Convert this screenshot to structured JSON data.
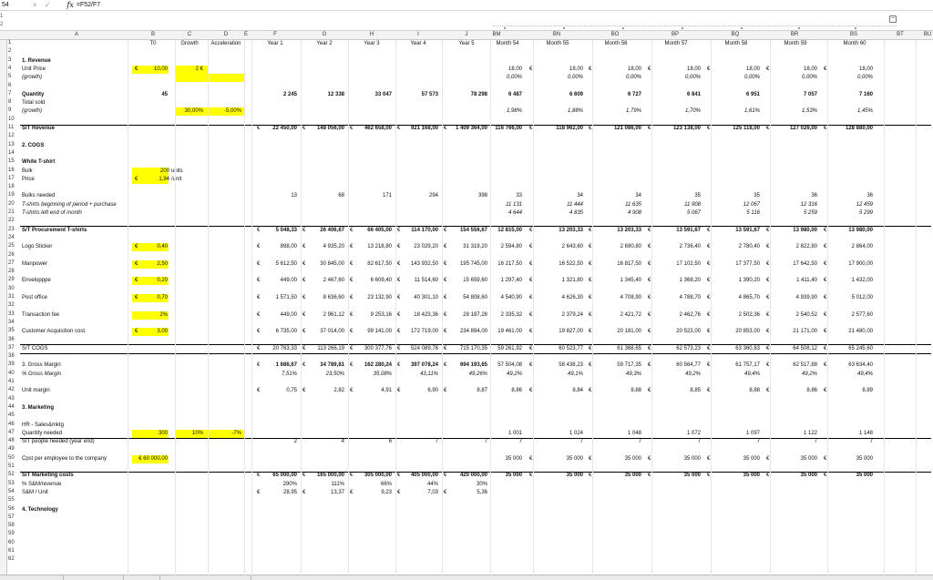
{
  "formula_bar": {
    "cell_ref": "54",
    "cancel": "×",
    "confirm": "✓",
    "fx": "fx",
    "formula": "=F52/F7"
  },
  "columns": [
    "A",
    "B",
    "C",
    "D",
    "E",
    "F",
    "G",
    "H",
    "I",
    "J",
    "BM",
    "BN",
    "BO",
    "BP",
    "BQ",
    "BR",
    "BS",
    "BT",
    "BU"
  ],
  "header_row": {
    "rn": "1",
    "b": "T0",
    "c": "Growth",
    "d": "Acceleration",
    "f": "Year 1",
    "g": "Year 2",
    "h": "Year 3",
    "i": "Year 4",
    "j": "Year 5",
    "bm": "Month 54",
    "bn": "Month 55",
    "bo": "Month 56",
    "bp": "Month 57",
    "bq": "Month 58",
    "br": "Month 59",
    "bs": "Month 60"
  },
  "euro": "€",
  "rows": [
    {
      "rn": "2"
    },
    {
      "rn": "3",
      "a": "1. Revenue",
      "bold": true
    },
    {
      "rn": "4",
      "a": "Unit Price",
      "b": "10,00",
      "b_euro": true,
      "b_hl": true,
      "c": "2 €",
      "c_hl": true,
      "months": [
        "18,00",
        "18,00",
        "18,00",
        "18,00",
        "18,00",
        "18,00",
        "18,00"
      ],
      "month_euro": true
    },
    {
      "rn": "5",
      "a": "(growth)",
      "italic": true,
      "c_hl": true,
      "d_hl": true,
      "months": [
        "0,00%",
        "0,00%",
        "0,00%",
        "0,00%",
        "0,00%",
        "0,00%",
        "0,00%"
      ],
      "mitalic": true
    },
    {
      "rn": "6"
    },
    {
      "rn": "7",
      "a": "Quantity",
      "b": "45",
      "years": [
        "2 245",
        "12 338",
        "33 047",
        "57 573",
        "78 298"
      ],
      "months": [
        "6 487",
        "6 609",
        "6 727",
        "6 841",
        "6 951",
        "7 057",
        "7 160"
      ],
      "bold": true
    },
    {
      "rn": "8",
      "a": "Total sold"
    },
    {
      "rn": "9",
      "a": "(growth)",
      "italic": true,
      "c": "30,00%",
      "c_hl": true,
      "d": "-5,00%",
      "d_hl": true,
      "months": [
        "1,98%",
        "1,88%",
        "1,79%",
        "1,70%",
        "1,61%",
        "1,53%",
        "1,45%"
      ],
      "mitalic": true
    },
    {
      "rn": "10"
    },
    {
      "rn": "11",
      "a": "S/T Revenue",
      "bold": true,
      "year_euro": true,
      "years": [
        "22 450,00",
        "148 056,00",
        "462 658,00",
        "921 168,00",
        "1 409 364,00"
      ],
      "months": [
        "116 766,00",
        "118 962,00",
        "121 086,00",
        "123 138,00",
        "125 118,00",
        "127 026,00",
        "128 880,00"
      ],
      "month_euro": true,
      "rule_top": true
    },
    {
      "rn": "12"
    },
    {
      "rn": "13",
      "a": "2. COGS",
      "bold": true
    },
    {
      "rn": "14"
    },
    {
      "rn": "15",
      "a": "White T-shirt",
      "bold": true
    },
    {
      "rn": "16",
      "a": "Bulk",
      "b": "200",
      "b_hl": true,
      "c": "units"
    },
    {
      "rn": "17",
      "a": "Price",
      "b": "1,94",
      "b_euro": true,
      "b_hl": true,
      "c": "/unit"
    },
    {
      "rn": "18"
    },
    {
      "rn": "19",
      "a": "Bulks needed",
      "years": [
        "13",
        "68",
        "171",
        "294",
        "398"
      ],
      "months": [
        "33",
        "34",
        "34",
        "35",
        "35",
        "36",
        "36"
      ]
    },
    {
      "rn": "20",
      "a": "T-shirts beginning of period + purchase",
      "italic": true,
      "months": [
        "11 131",
        "11 444",
        "11 635",
        "11 908",
        "12 067",
        "12 316",
        "12 459"
      ],
      "mitalic": true
    },
    {
      "rn": "21",
      "a": "T-shirts left end of month",
      "italic": true,
      "months": [
        "4 644",
        "4 835",
        "4 908",
        "5 067",
        "5 116",
        "5 259",
        "5 299"
      ],
      "mitalic": true
    },
    {
      "rn": "22"
    },
    {
      "rn": "23",
      "a": "S/T Procurement T-shirts",
      "bold": true,
      "year_euro": true,
      "years": [
        "5 048,33",
        "26 406,67",
        "66 405,00",
        "114 170,00",
        "154 556,67"
      ],
      "months": [
        "12 815,00",
        "13 203,33",
        "13 203,33",
        "13 591,67",
        "13 591,67",
        "13 980,00",
        "13 980,00"
      ],
      "month_euro": true,
      "rule_top": true
    },
    {
      "rn": "24"
    },
    {
      "rn": "25",
      "a": "Logo Sticker",
      "b": "0,40",
      "b_euro": true,
      "b_hl": true,
      "year_euro": true,
      "years": [
        "898,00",
        "4 935,20",
        "13 218,80",
        "23 029,20",
        "31 319,20"
      ],
      "months": [
        "2 594,80",
        "2 643,60",
        "2 690,80",
        "2 736,40",
        "2 780,40",
        "2 822,80",
        "2 864,00"
      ],
      "month_euro": true
    },
    {
      "rn": "26"
    },
    {
      "rn": "27",
      "a": "Manpower",
      "b": "2,50",
      "b_euro": true,
      "b_hl": true,
      "year_euro": true,
      "years": [
        "5 612,50",
        "30 845,00",
        "82 617,50",
        "143 932,50",
        "195 745,00"
      ],
      "months": [
        "16 217,50",
        "16 522,50",
        "16 817,50",
        "17 102,50",
        "17 377,50",
        "17 642,50",
        "17 900,00"
      ],
      "month_euro": true
    },
    {
      "rn": "28"
    },
    {
      "rn": "29",
      "a": "Envelopppe",
      "b": "0,20",
      "b_euro": true,
      "b_hl": true,
      "year_euro": true,
      "years": [
        "449,00",
        "2 467,60",
        "6 609,40",
        "11 514,60",
        "15 659,60"
      ],
      "months": [
        "1 297,40",
        "1 321,80",
        "1 345,40",
        "1 368,20",
        "1 390,20",
        "1 411,40",
        "1 432,00"
      ],
      "month_euro": true
    },
    {
      "rn": "30"
    },
    {
      "rn": "31",
      "a": "Post office",
      "b": "0,70",
      "b_euro": true,
      "b_hl": true,
      "year_euro": true,
      "years": [
        "1 571,50",
        "8 636,60",
        "23 132,90",
        "40 301,10",
        "54 808,60"
      ],
      "months": [
        "4 540,90",
        "4 626,30",
        "4 708,90",
        "4 788,70",
        "4 865,70",
        "4 939,90",
        "5 012,00"
      ],
      "month_euro": true
    },
    {
      "rn": "32"
    },
    {
      "rn": "33",
      "a": "Transaction fee",
      "b": "2%",
      "b_hl": true,
      "year_euro": true,
      "years": [
        "449,00",
        "2 961,12",
        "9 253,16",
        "18 423,36",
        "28 187,28"
      ],
      "months": [
        "2 335,32",
        "2 379,24",
        "2 421,72",
        "2 462,76",
        "2 502,36",
        "2 540,52",
        "2 577,60"
      ],
      "month_euro": true
    },
    {
      "rn": "34"
    },
    {
      "rn": "35",
      "a": "Customer Acquisition cost.",
      "b": "3,00",
      "b_euro": true,
      "b_hl": true,
      "year_euro": true,
      "years": [
        "6 735,00",
        "37 014,00",
        "99 141,00",
        "172 719,00",
        "234 894,00"
      ],
      "months": [
        "19 461,00",
        "19 827,00",
        "20 181,00",
        "20 523,00",
        "20 853,00",
        "21 171,00",
        "21 480,00"
      ],
      "month_euro": true
    },
    {
      "rn": "36"
    },
    {
      "rn": "37",
      "a": "S/T COGS",
      "year_euro": true,
      "years": [
        "20 763,33",
        "113 266,19",
        "300 377,76",
        "524 089,76",
        "715 170,35"
      ],
      "months": [
        "59 261,92",
        "60 523,77",
        "61 368,65",
        "62 573,23",
        "63 360,83",
        "64 508,12",
        "65 245,60"
      ],
      "month_euro": true,
      "rule_top": true,
      "rule_bottom": true
    },
    {
      "rn": "38"
    },
    {
      "rn": "39",
      "a": "3. Gross Margin",
      "bold_years": true,
      "year_euro": true,
      "years": [
        "1 686,67",
        "34 789,81",
        "162 280,24",
        "397 078,24",
        "694 193,65"
      ],
      "months": [
        "57 504,08",
        "58 438,23",
        "59 717,35",
        "60 564,77",
        "61 757,17",
        "62 517,88",
        "63 634,40"
      ],
      "month_euro": true
    },
    {
      "rn": "40",
      "a": "% Gross Margin",
      "italic": true,
      "years": [
        "7,51%",
        "23,50%",
        "35,08%",
        "43,11%",
        "49,26%"
      ],
      "yitalic": true,
      "months": [
        "49,2%",
        "49,1%",
        "49,3%",
        "49,2%",
        "49,4%",
        "49,2%",
        "49,4%"
      ],
      "mitalic": true
    },
    {
      "rn": "41"
    },
    {
      "rn": "42",
      "a": "Unit margin",
      "year_euro": true,
      "years": [
        "0,75",
        "2,82",
        "4,91",
        "6,90",
        "8,87"
      ],
      "months": [
        "8,86",
        "8,84",
        "8,88",
        "8,85",
        "8,88",
        "8,86",
        "8,89"
      ],
      "month_euro": true
    },
    {
      "rn": "43"
    },
    {
      "rn": "44",
      "a": "3. Marketing",
      "bold": true
    },
    {
      "rn": "45"
    },
    {
      "rn": "46",
      "a": "HR - Sales&mktg"
    },
    {
      "rn": "47",
      "a": "Quantity needed",
      "b": "300",
      "b_hl": true,
      "c": "10%",
      "c_hl": true,
      "d": "-7%",
      "d_hl": true,
      "months": [
        "1 001",
        "1 024",
        "1 048",
        "1 072",
        "1 097",
        "1 122",
        "1 148"
      ]
    },
    {
      "rn": "48",
      "a": "S/T people needed (year end)",
      "years": [
        "2",
        "4",
        "6",
        "7",
        "7"
      ],
      "months": [
        "7",
        "7",
        "7",
        "7",
        "7",
        "7",
        "7"
      ],
      "rule_top": true
    },
    {
      "rn": "49"
    },
    {
      "rn": "50",
      "a": "Cpst per employee to the company",
      "b": "€ 60 000,00",
      "b_hl": true,
      "months": [
        "35 000",
        "35 000",
        "35 000",
        "35 000",
        "35 000",
        "35 000",
        "35 000"
      ],
      "month_euro": true
    },
    {
      "rn": "51"
    },
    {
      "rn": "52",
      "a": "S/T Marketing costs",
      "bold": true,
      "year_euro": true,
      "years": [
        "65 000,00",
        "165 000,00",
        "305 000,00",
        "405 000,00",
        "420 000,00"
      ],
      "months": [
        "35 000",
        "35 000",
        "35 000",
        "35 000",
        "35 000",
        "35 000",
        "35 000"
      ],
      "month_euro": true,
      "rule_top": true
    },
    {
      "rn": "53",
      "a": "% S&M/revenue",
      "years": [
        "290%",
        "111%",
        "66%",
        "44%",
        "30%"
      ]
    },
    {
      "rn": "54",
      "a": "S&M / Unit",
      "year_euro": true,
      "years": [
        "28,95",
        "13,37",
        "9,23",
        "7,03",
        "5,36"
      ]
    },
    {
      "rn": "55"
    },
    {
      "rn": "56",
      "a": "4. Technology",
      "bold": true
    },
    {
      "rn": "57"
    },
    {
      "rn": "58"
    },
    {
      "rn": "59"
    },
    {
      "rn": "60"
    },
    {
      "rn": "61"
    },
    {
      "rn": "62"
    }
  ]
}
